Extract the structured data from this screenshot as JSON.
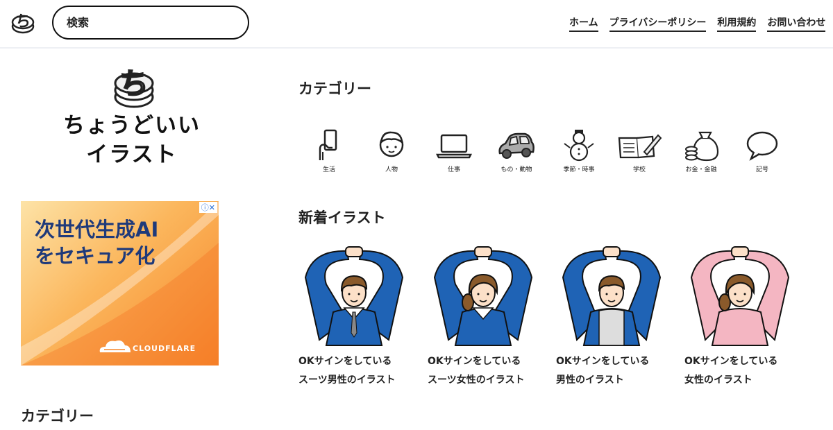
{
  "header": {
    "search_placeholder": "検索",
    "nav": [
      "ホーム",
      "プライバシーポリシー",
      "利用規約",
      "お問い合わせ"
    ]
  },
  "site": {
    "title_line1": "ちょうどいい",
    "title_line2": "イラスト"
  },
  "ad": {
    "line1": "次世代生成AI",
    "line2": "をセキュア化",
    "brand": "CLOUDFLARE",
    "badge": "ⓘ✕"
  },
  "sidebar": {
    "category_heading": "カテゴリー"
  },
  "main": {
    "category_heading": "カテゴリー",
    "categories": [
      {
        "label": "生活",
        "icon": "smartphone-hand-icon"
      },
      {
        "label": "人物",
        "icon": "person-icon"
      },
      {
        "label": "仕事",
        "icon": "laptop-icon"
      },
      {
        "label": "もの・動物",
        "icon": "car-icon"
      },
      {
        "label": "季節・時事",
        "icon": "snowman-icon"
      },
      {
        "label": "学校",
        "icon": "notebook-pencil-icon"
      },
      {
        "label": "お金・金融",
        "icon": "money-bag-icon"
      },
      {
        "label": "記号",
        "icon": "speech-bubble-icon"
      }
    ],
    "new_heading": "新着イラスト",
    "illustrations": [
      {
        "caption1": "OKサインをしている",
        "caption2": "スーツ男性のイラスト",
        "colors": {
          "body": "#1f63b5",
          "hair": "#8a5a2b"
        }
      },
      {
        "caption1": "OKサインをしている",
        "caption2": "スーツ女性のイラスト",
        "colors": {
          "body": "#1f63b5",
          "hair": "#8a5a2b"
        }
      },
      {
        "caption1": "OKサインをしている",
        "caption2": "男性のイラスト",
        "colors": {
          "body": "#1f63b5",
          "hair": "#8a5a2b"
        }
      },
      {
        "caption1": "OKサインをしている",
        "caption2": "女性のイラスト",
        "colors": {
          "body": "#f4b6c2",
          "hair": "#8a5a2b"
        }
      }
    ]
  }
}
